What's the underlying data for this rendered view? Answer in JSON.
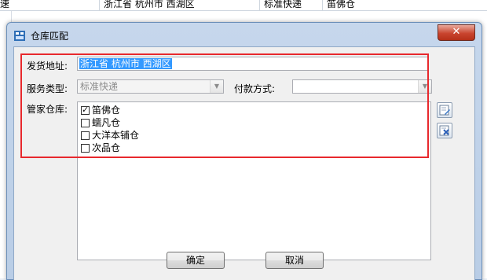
{
  "background_row": {
    "col1": "速",
    "col2": "浙江省 杭州市 西湖区",
    "col3": "标准快递",
    "col4": "笛佛仓"
  },
  "dialog": {
    "title": "仓库匹配",
    "close_icon": "close-x-icon",
    "fields": {
      "ship_address_label": "发货地址:",
      "ship_address_value": "浙江省 杭州市 西湖区",
      "service_type_label": "服务类型:",
      "service_type_value": "标准快递",
      "payment_label": "付款方式:",
      "payment_value": "",
      "warehouse_label": "管家仓库:"
    },
    "warehouses": [
      {
        "name": "笛佛仓",
        "checked": true
      },
      {
        "name": "蠕凡仓",
        "checked": false
      },
      {
        "name": "大洋本铺仓",
        "checked": false
      },
      {
        "name": "次品仓",
        "checked": false
      }
    ],
    "buttons": {
      "ok": "确定",
      "cancel": "取消"
    },
    "highlight_color": "#e8282d"
  }
}
